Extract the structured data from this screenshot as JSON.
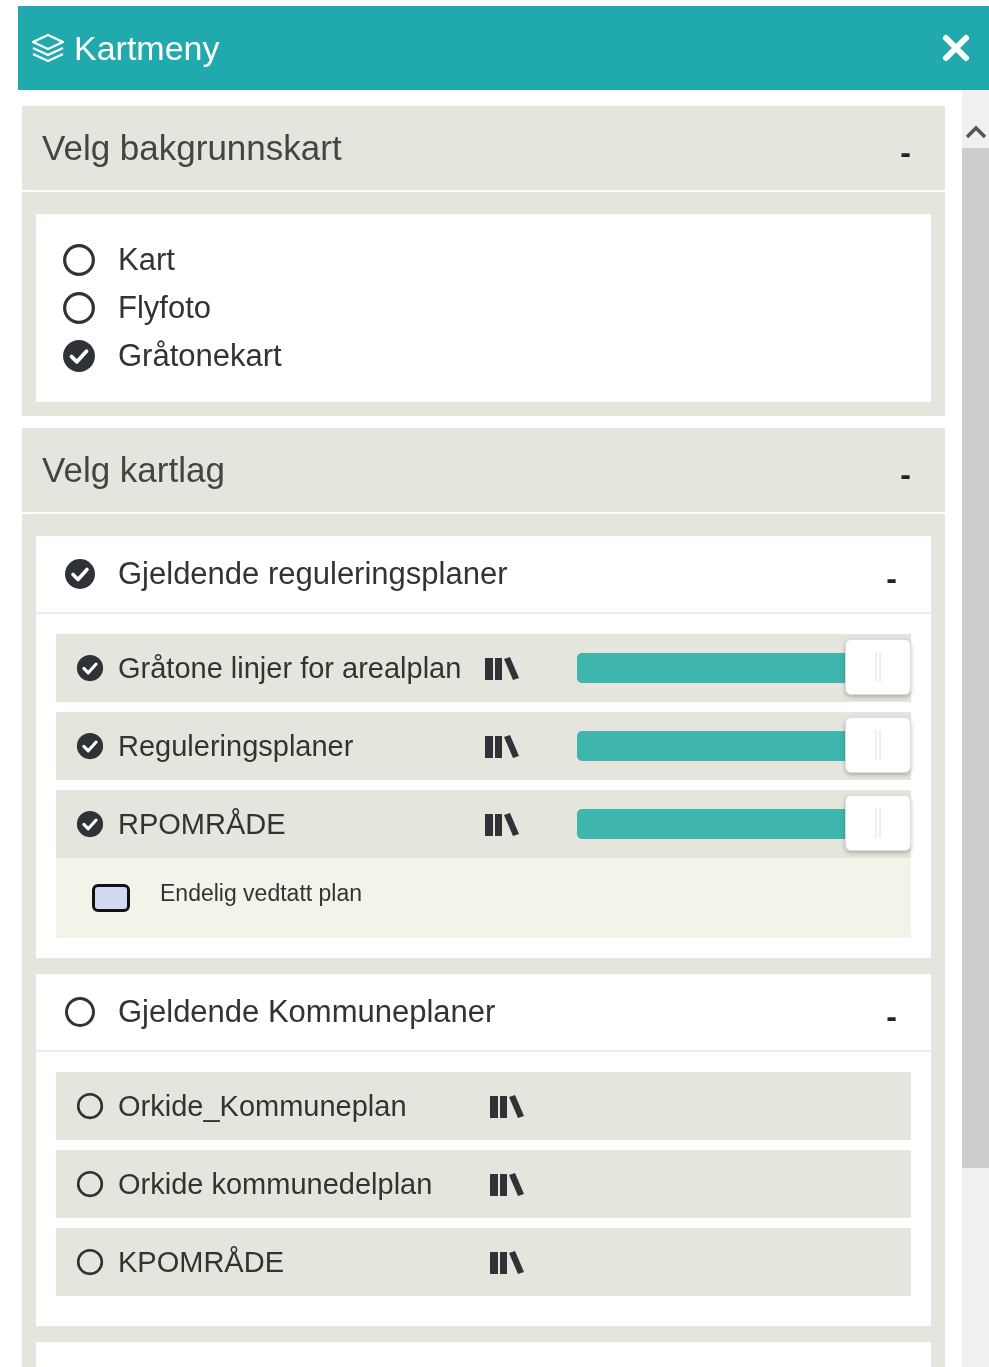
{
  "panel": {
    "title": "Kartmeny"
  },
  "sections": [
    {
      "kind": "basemaps",
      "title": "Velg bakgrunnskart",
      "toggle": "-",
      "options": [
        {
          "label": "Kart",
          "selected": false
        },
        {
          "label": "Flyfoto",
          "selected": false
        },
        {
          "label": "Gråtonekart",
          "selected": true
        }
      ]
    },
    {
      "kind": "layers",
      "title": "Velg kartlag",
      "toggle": "-",
      "groups": [
        {
          "title": "Gjeldende reguleringsplaner",
          "checked": true,
          "toggle": "-",
          "layers": [
            {
              "name": "Gråtone linjer for arealplan",
              "checked": true,
              "level": 1
            },
            {
              "name": "Reguleringsplaner",
              "checked": true,
              "level": 1
            },
            {
              "name": "RPOMRÅDE",
              "checked": true,
              "level": 1,
              "legend": [
                {
                  "label": "Endelig vedtatt plan",
                  "color": "#cfdaf2"
                }
              ]
            }
          ]
        },
        {
          "title": "Gjeldende Kommuneplaner",
          "checked": false,
          "toggle": "-",
          "layers": [
            {
              "name": "Orkide_Kommuneplan",
              "checked": false
            },
            {
              "name": "Orkide kommunedelplan",
              "checked": false
            },
            {
              "name": "KPOMRÅDE",
              "checked": false
            }
          ]
        }
      ]
    }
  ]
}
